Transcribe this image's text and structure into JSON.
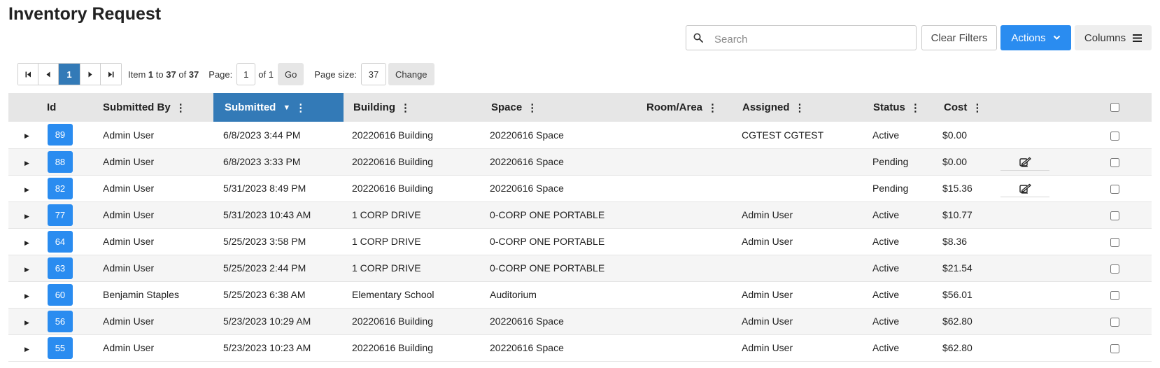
{
  "page": {
    "title": "Inventory Request"
  },
  "toolbar": {
    "search_placeholder": "Search",
    "search_icon": "search-icon",
    "clear_filters_label": "Clear Filters",
    "actions_label": "Actions",
    "columns_label": "Columns",
    "accent_color": "#2a8cf0"
  },
  "pager": {
    "current_page": "1",
    "item_prefix": "Item",
    "item_start": "1",
    "item_to": "to",
    "item_end": "37",
    "item_of": "of",
    "item_total": "37",
    "page_label": "Page:",
    "page_value": "1",
    "page_of": "of 1",
    "go_label": "Go",
    "page_size_label": "Page size:",
    "page_size_value": "37",
    "change_label": "Change"
  },
  "table": {
    "columns": [
      "Id",
      "Submitted By",
      "Submitted",
      "Building",
      "Space",
      "Room/Area",
      "Assigned",
      "Status",
      "Cost"
    ],
    "sorted_column": "Submitted",
    "sort_direction": "descending",
    "header_sorted_color": "#337ab7",
    "rows": [
      {
        "id": "89",
        "submitted_by": "Admin User",
        "submitted": "6/8/2023 3:44 PM",
        "building": "20220616 Building",
        "space": "20220616 Space",
        "room": "",
        "assigned": "CGTEST CGTEST",
        "status": "Active",
        "cost": "$0.00",
        "edit": false
      },
      {
        "id": "88",
        "submitted_by": "Admin User",
        "submitted": "6/8/2023 3:33 PM",
        "building": "20220616 Building",
        "space": "20220616 Space",
        "room": "",
        "assigned": "",
        "status": "Pending",
        "cost": "$0.00",
        "edit": true
      },
      {
        "id": "82",
        "submitted_by": "Admin User",
        "submitted": "5/31/2023 8:49 PM",
        "building": "20220616 Building",
        "space": "20220616 Space",
        "room": "",
        "assigned": "",
        "status": "Pending",
        "cost": "$15.36",
        "edit": true
      },
      {
        "id": "77",
        "submitted_by": "Admin User",
        "submitted": "5/31/2023 10:43 AM",
        "building": "1 CORP DRIVE",
        "space": "0-CORP ONE PORTABLE",
        "room": "",
        "assigned": "Admin User",
        "status": "Active",
        "cost": "$10.77",
        "edit": false
      },
      {
        "id": "64",
        "submitted_by": "Admin User",
        "submitted": "5/25/2023 3:58 PM",
        "building": "1 CORP DRIVE",
        "space": "0-CORP ONE PORTABLE",
        "room": "",
        "assigned": "Admin User",
        "status": "Active",
        "cost": "$8.36",
        "edit": false
      },
      {
        "id": "63",
        "submitted_by": "Admin User",
        "submitted": "5/25/2023 2:44 PM",
        "building": "1 CORP DRIVE",
        "space": "0-CORP ONE PORTABLE",
        "room": "",
        "assigned": "",
        "status": "Active",
        "cost": "$21.54",
        "edit": false
      },
      {
        "id": "60",
        "submitted_by": "Benjamin Staples",
        "submitted": "5/25/2023 6:38 AM",
        "building": "Elementary School",
        "space": "Auditorium",
        "room": "",
        "assigned": "Admin User",
        "status": "Active",
        "cost": "$56.01",
        "edit": false
      },
      {
        "id": "56",
        "submitted_by": "Admin User",
        "submitted": "5/23/2023 10:29 AM",
        "building": "20220616 Building",
        "space": "20220616 Space",
        "room": "",
        "assigned": "Admin User",
        "status": "Active",
        "cost": "$62.80",
        "edit": false
      },
      {
        "id": "55",
        "submitted_by": "Admin User",
        "submitted": "5/23/2023 10:23 AM",
        "building": "20220616 Building",
        "space": "20220616 Space",
        "room": "",
        "assigned": "Admin User",
        "status": "Active",
        "cost": "$62.80",
        "edit": false
      }
    ]
  }
}
